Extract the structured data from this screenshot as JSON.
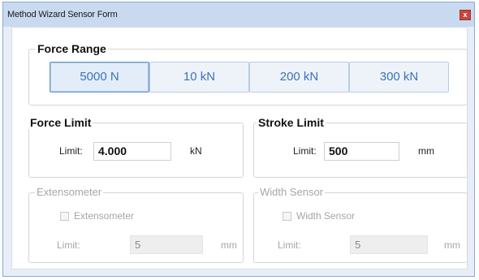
{
  "window": {
    "title": "Method Wizard Sensor Form",
    "close_glyph": "x"
  },
  "force_range": {
    "legend": "Force Range",
    "options": [
      "5000 N",
      "10 kN",
      "200 kN",
      "300 kN"
    ],
    "selected_index": 0
  },
  "force_limit": {
    "legend": "Force Limit",
    "label": "Limit:",
    "value": "4.000",
    "unit": "kN"
  },
  "stroke_limit": {
    "legend": "Stroke Limit",
    "label": "Limit:",
    "value": "500",
    "unit": "mm"
  },
  "extensometer": {
    "legend": "Extensometer",
    "checkbox_label": "Extensometer",
    "checked": false,
    "limit_label": "Limit:",
    "value": "5",
    "unit": "mm"
  },
  "width_sensor": {
    "legend": "Width Sensor",
    "checkbox_label": "Width Sensor",
    "checked": false,
    "limit_label": "Limit:",
    "value": "5",
    "unit": "mm"
  },
  "colors": {
    "titlebar": "#c9daf0",
    "close_button": "#c9453a",
    "accent_text": "#3b73b9",
    "disabled_text": "#a6a6a6"
  }
}
